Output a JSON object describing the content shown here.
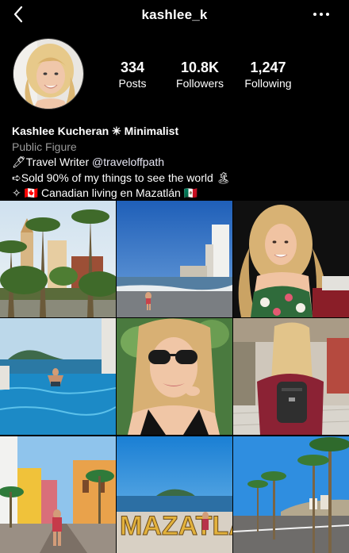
{
  "header": {
    "username": "kashlee_k",
    "back_icon": "chevron-left-icon",
    "more_icon": "more-horizontal-icon"
  },
  "stats": {
    "posts": {
      "value": "334",
      "label": "Posts"
    },
    "followers": {
      "value": "10.8K",
      "label": "Followers"
    },
    "following": {
      "value": "1,247",
      "label": "Following"
    }
  },
  "bio": {
    "name": "Kashlee Kucheran ✳ Minimalist",
    "category": "Public Figure",
    "line1_prefix": "🖊Travel Writer ",
    "line1_handle": "@traveloffpath",
    "line2": "➪Sold 90% of my things to see the world 🏝",
    "line3": "✧ 🇨🇦 Canadian living en Mazatlán 🇲🇽"
  },
  "grid": {
    "posts": [
      {
        "name": "photo-town-palms"
      },
      {
        "name": "photo-beach-skyline"
      },
      {
        "name": "photo-portrait-floral"
      },
      {
        "name": "photo-infinity-pool"
      },
      {
        "name": "photo-sunglasses-selfie"
      },
      {
        "name": "photo-mall-backpack"
      },
      {
        "name": "photo-colorful-street"
      },
      {
        "name": "photo-mazatlan-letters"
      },
      {
        "name": "photo-palm-avenue"
      }
    ],
    "letters_text": "MAZATLA"
  },
  "colors": {
    "background": "#000000",
    "text": "#ffffff",
    "muted": "#9a9a9a"
  }
}
